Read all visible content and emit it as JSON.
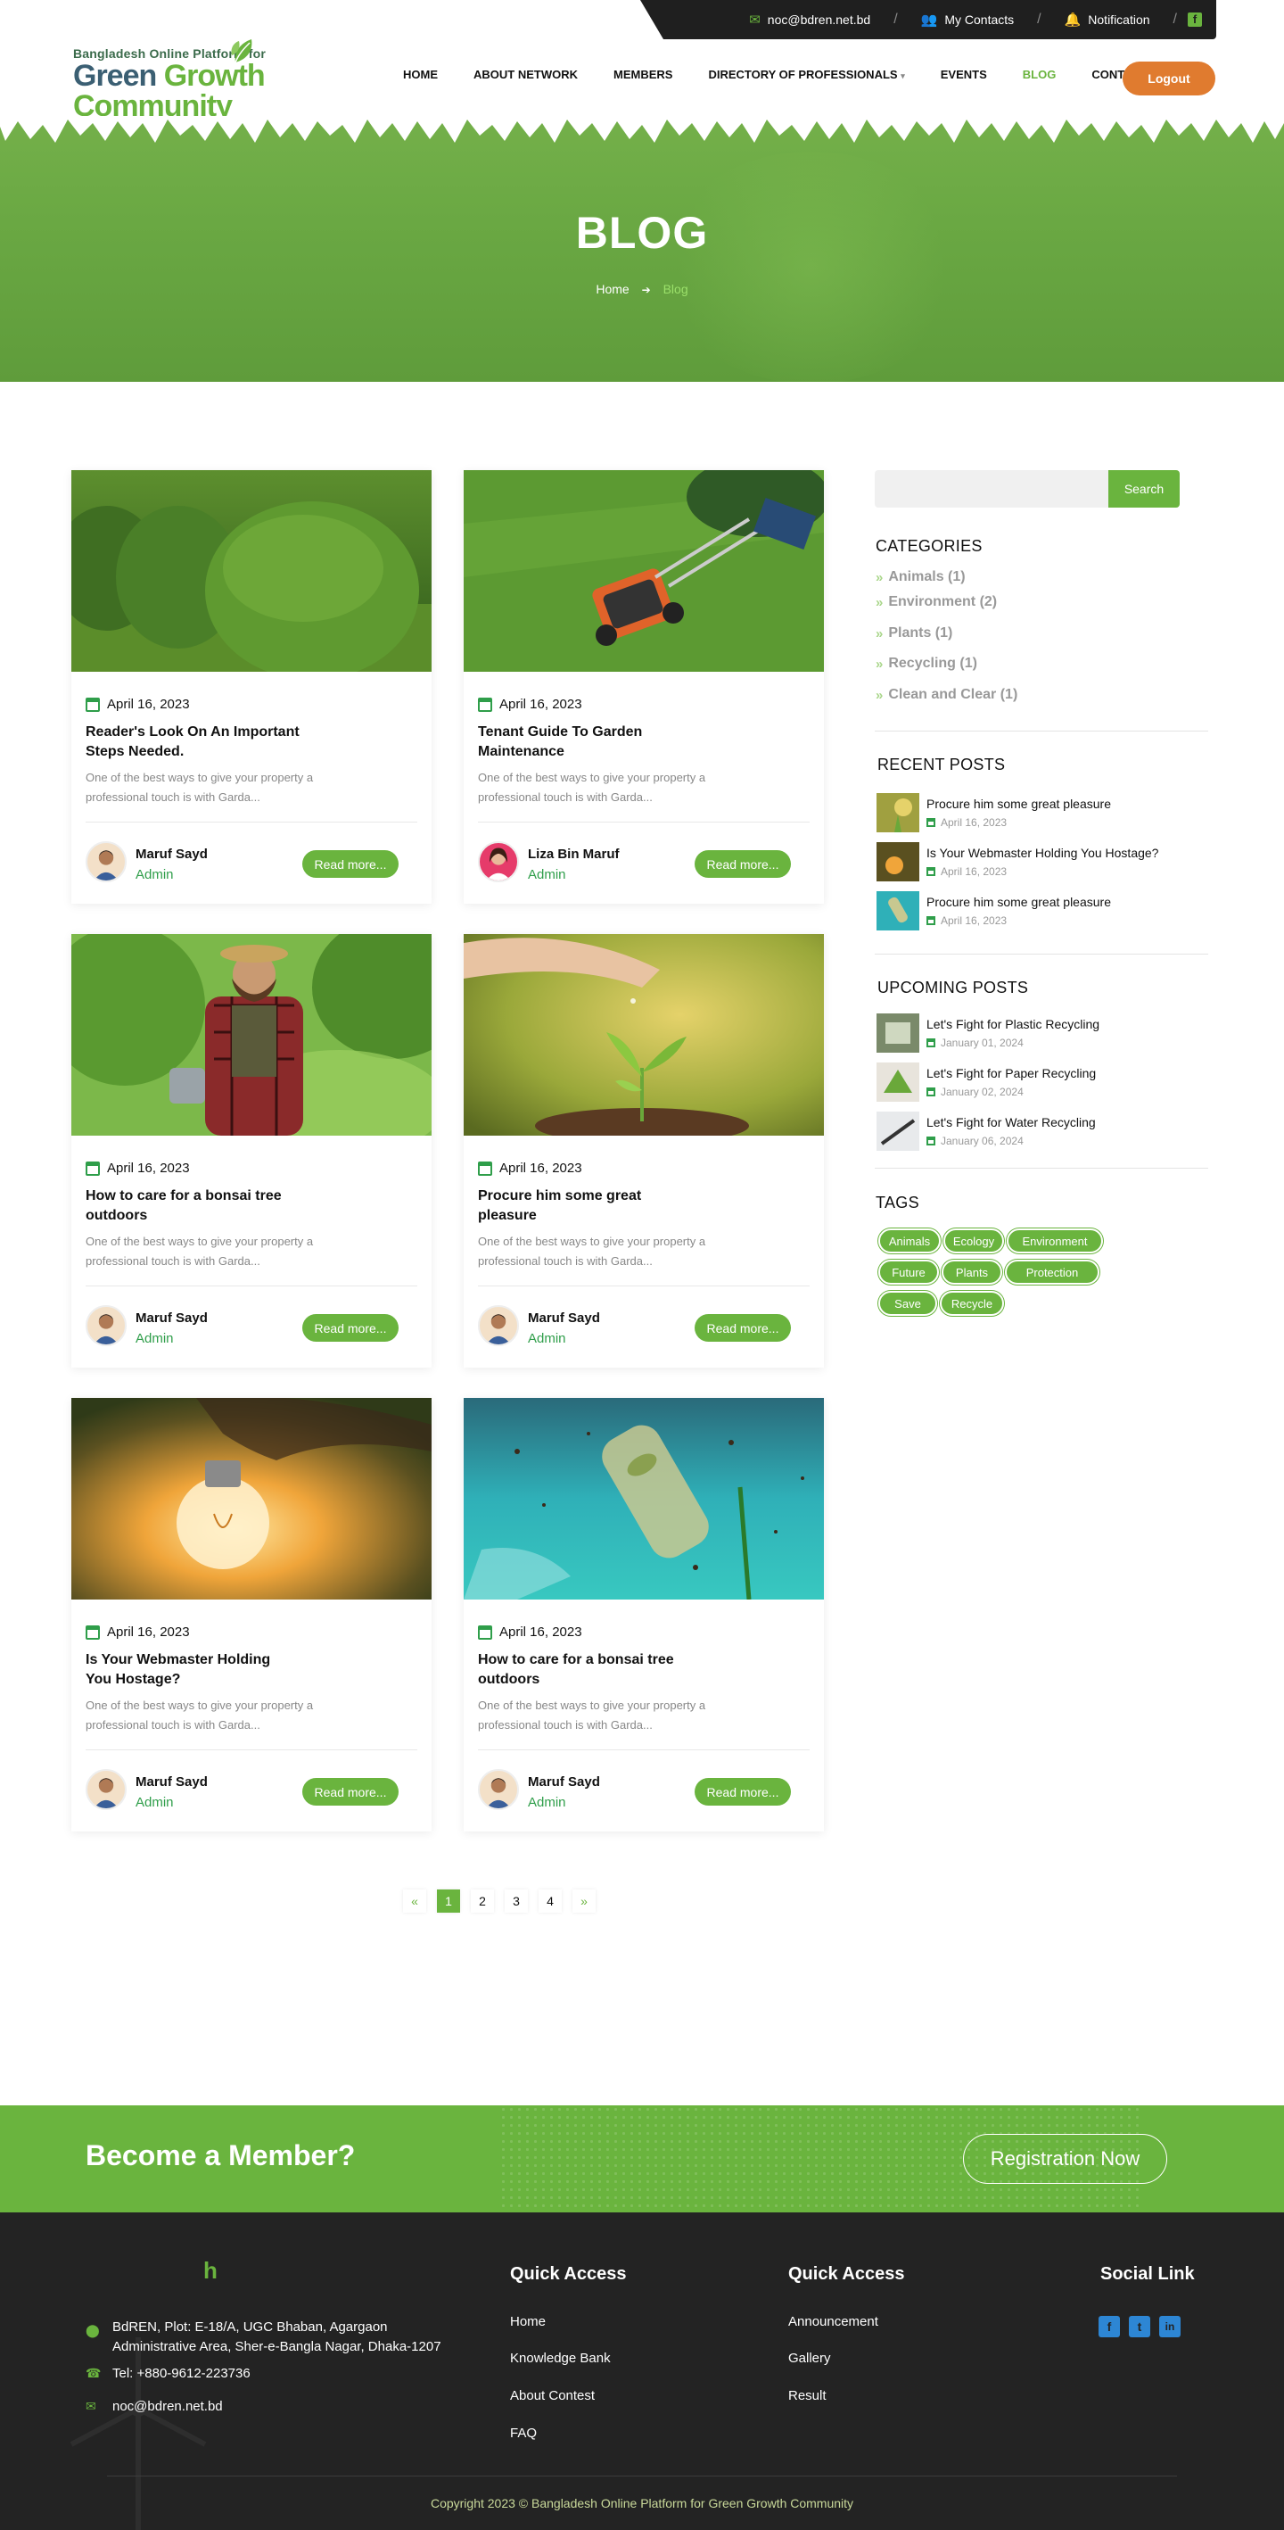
{
  "topbar": {
    "email": "noc@bdren.net.bd",
    "contacts": "My Contacts",
    "notification": "Notification",
    "separator": "/",
    "fb": "f"
  },
  "logo": {
    "line1": "Bangladesh Online Platform for",
    "word1": "Green",
    "word2": "Growth Community"
  },
  "nav": {
    "items": [
      "HOME",
      "ABOUT NETWORK",
      "MEMBERS",
      "DIRECTORY OF PROFESSIONALS",
      "EVENTS",
      "BLOG",
      "CONTACT US"
    ],
    "dropdown_marker": "▾",
    "logout": "Logout"
  },
  "hero": {
    "title": "BLOG",
    "breadcrumb_home": "Home",
    "breadcrumb_arrow": "➔",
    "breadcrumb_current": "Blog"
  },
  "posts": [
    {
      "date": "April 16, 2023",
      "title": "Reader's Look On An Important Steps Needed.",
      "excerpt": "One of the best ways to give your property a professional touch is with Garda...",
      "author": "Maruf Sayd",
      "role": "Admin",
      "more": "Read more..."
    },
    {
      "date": "April 16, 2023",
      "title": "Tenant Guide To Garden Maintenance",
      "excerpt": "One of the best ways to give your property a professional touch is with Garda...",
      "author": "Liza Bin Maruf",
      "role": "Admin",
      "more": "Read more..."
    },
    {
      "date": "April 16, 2023",
      "title": "How to care for a bonsai tree outdoors",
      "excerpt": "One of the best ways to give your property a professional touch is with Garda...",
      "author": "Maruf Sayd",
      "role": "Admin",
      "more": "Read more..."
    },
    {
      "date": "April 16, 2023",
      "title": "Procure him some great pleasure",
      "excerpt": "One of the best ways to give your property a professional touch is with Garda...",
      "author": "Maruf Sayd",
      "role": "Admin",
      "more": "Read more..."
    },
    {
      "date": "April 16, 2023",
      "title": "Is Your Webmaster Holding You Hostage?",
      "excerpt": "One of the best ways to give your property a professional touch is with Garda...",
      "author": "Maruf Sayd",
      "role": "Admin",
      "more": "Read more..."
    },
    {
      "date": "April 16, 2023",
      "title": "How to care for a bonsai tree outdoors",
      "excerpt": "One of the best ways to give your property a professional touch is with Garda...",
      "author": "Maruf Sayd",
      "role": "Admin",
      "more": "Read more..."
    }
  ],
  "sidebar": {
    "search_placeholder": "",
    "search_button": "Search",
    "categories_title": "CATEGORIES",
    "category_marker": "»",
    "categories": [
      "Animals (1)",
      "Environment (2)",
      "Plants (1)",
      "Recycling (1)",
      "Clean and Clear (1)"
    ],
    "recent_title": "RECENT POSTS",
    "recent": [
      {
        "title": "Procure him some great pleasure",
        "date": "April 16, 2023"
      },
      {
        "title": "Is Your Webmaster Holding You Hostage?",
        "date": "April 16, 2023"
      },
      {
        "title": "Procure him some great pleasure",
        "date": "April 16, 2023"
      }
    ],
    "upcoming_title": "UPCOMING POSTS",
    "upcoming": [
      {
        "title": "Let's Fight for Plastic Recycling",
        "date": "January  01, 2024"
      },
      {
        "title": "Let's Fight for Paper Recycling",
        "date": "January  02, 2024"
      },
      {
        "title": "Let's Fight for Water Recycling",
        "date": "January  06, 2024"
      }
    ],
    "tags_title": "TAGS",
    "tags": [
      "Animals",
      "Ecology",
      "Environment",
      "Future",
      "Plants",
      "Protection",
      "Save",
      "Recycle"
    ]
  },
  "pagination": {
    "prev": "«",
    "pages": [
      "1",
      "2",
      "3",
      "4"
    ],
    "current": "1",
    "next": "»"
  },
  "member": {
    "title": "Become a Member?",
    "button": "Registration Now"
  },
  "footer": {
    "logo_letter": "h",
    "address": "BdREN, Plot: E-18/A, UGC Bhaban, Agargaon Administrative Area, Sher-e-Bangla Nagar, Dhaka-1207",
    "tel": "Tel: +880-9612-223736",
    "email": "noc@bdren.net.bd",
    "quick1_title": "Quick Access",
    "quick1": [
      "Home",
      "Knowledge Bank",
      "About Contest",
      "FAQ"
    ],
    "quick2_title": "Quick Access",
    "quick2": [
      "Announcement",
      "Gallery",
      "Result"
    ],
    "social_title": "Social Link",
    "social_glyphs": [
      "f",
      "t",
      "in"
    ],
    "copyright": "Copyright 2023 © Bangladesh Online Platform for Green Growth Community"
  },
  "colors": {
    "accent": "#6ab43e",
    "dark": "#232323",
    "logout": "#e07b2f",
    "date_icon": "#2f9e4a"
  }
}
